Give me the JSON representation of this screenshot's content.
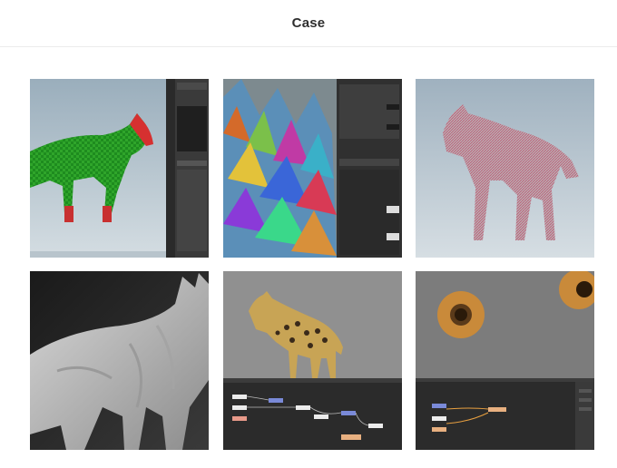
{
  "header": {
    "title": "Case"
  },
  "gallery": {
    "items": [
      {
        "subject": "hyena-uv-checker-render"
      },
      {
        "subject": "spike-geometry-viewport"
      },
      {
        "subject": "hyena-fur-wireframe"
      },
      {
        "subject": "hyena-sculpt-closeup"
      },
      {
        "subject": "spotted-hyena-node-graph"
      },
      {
        "subject": "donut-shader-node-graph"
      }
    ]
  }
}
